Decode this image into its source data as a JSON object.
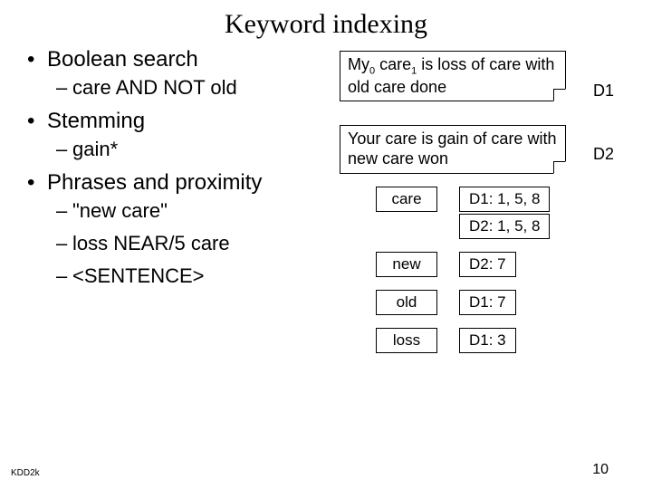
{
  "title": "Keyword indexing",
  "bullets": [
    {
      "text": "Boolean search",
      "sub": [
        "care AND NOT old"
      ]
    },
    {
      "text": "Stemming",
      "sub": [
        "gain*"
      ]
    },
    {
      "text": "Phrases and proximity",
      "sub": [
        "\"new care\"",
        "loss NEAR/5 care",
        "<SENTENCE>"
      ]
    }
  ],
  "docs": {
    "d1": {
      "label": "D1",
      "pre": "My",
      "s0": "0",
      "mid1": " care",
      "s1": "1",
      "rest": " is loss of care with old care done"
    },
    "d2": {
      "label": "D2",
      "text": "Your care is gain of care with new care won"
    }
  },
  "index": [
    {
      "key": "care",
      "vals": [
        "D1: 1, 5, 8",
        "D2: 1, 5, 8"
      ]
    },
    {
      "key": "new",
      "vals": [
        "D2: 7"
      ]
    },
    {
      "key": "old",
      "vals": [
        "D1: 7"
      ]
    },
    {
      "key": "loss",
      "vals": [
        "D1: 3"
      ]
    }
  ],
  "footer": {
    "left": "KDD2k",
    "right": "10"
  }
}
